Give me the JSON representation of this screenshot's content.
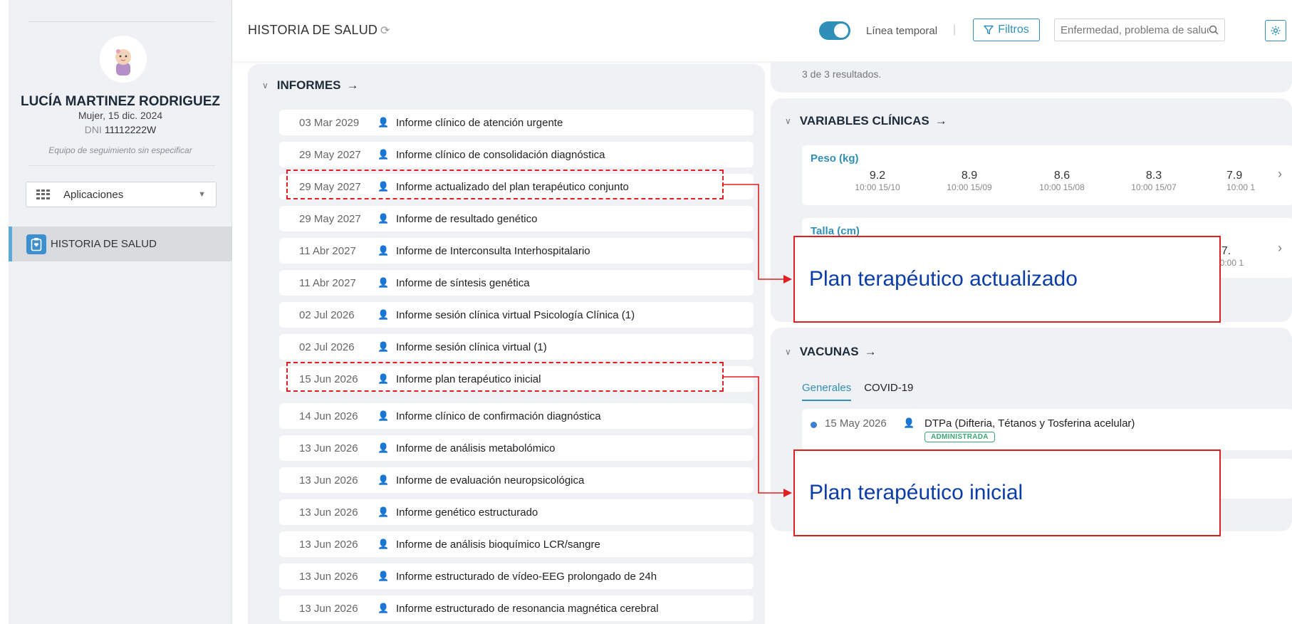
{
  "patient": {
    "name": "LUCÍA MARTINEZ RODRIGUEZ",
    "meta": "Mujer, 15 dic. 2024",
    "dni_label": "DNI",
    "dni_value": "11112222W",
    "team": "Equipo de seguimiento sin especificar"
  },
  "sidebar": {
    "apps_label": "Aplicaciones",
    "nav_item": "HISTORIA DE SALUD"
  },
  "header": {
    "title": "HISTORIA DE SALUD",
    "timeline_label": "Línea temporal",
    "timeline_on": true,
    "filters_label": "Filtros",
    "search_placeholder": "Enfermedad, problema de salud..."
  },
  "informes": {
    "heading": "INFORMES",
    "rows": [
      {
        "date": "03 Mar 2029",
        "title": "Informe clínico de atención urgente"
      },
      {
        "date": "29 May 2027",
        "title": "Informe clínico de consolidación diagnóstica"
      },
      {
        "date": "29 May 2027",
        "title": "Informe actualizado del plan terapéutico conjunto"
      },
      {
        "date": "29 May 2027",
        "title": "Informe de resultado genético"
      },
      {
        "date": "11 Abr 2027",
        "title": "Informe de Interconsulta Interhospitalario"
      },
      {
        "date": "11 Abr 2027",
        "title": "Informe de síntesis genética"
      },
      {
        "date": "02 Jul 2026",
        "title": "Informe sesión clínica virtual Psicología Clínica (1)"
      },
      {
        "date": "02 Jul 2026",
        "title": "Informe sesión clínica virtual (1)"
      },
      {
        "date": "15 Jun 2026",
        "title": "Informe plan terapéutico inicial"
      },
      {
        "date": "14 Jun 2026",
        "title": "Informe clínico de confirmación diagnóstica"
      },
      {
        "date": "13 Jun 2026",
        "title": "Informe de análisis metabolómico"
      },
      {
        "date": "13 Jun 2026",
        "title": "Informe de evaluación neuropsicológica"
      },
      {
        "date": "13 Jun 2026",
        "title": "Informe genético estructurado"
      },
      {
        "date": "13 Jun 2026",
        "title": "Informe de análisis bioquímico LCR/sangre"
      },
      {
        "date": "13 Jun 2026",
        "title": "Informe estructurado de vídeo-EEG prolongado de 24h"
      },
      {
        "date": "13 Jun 2026",
        "title": "Informe estructurado de resonancia magnética cerebral"
      }
    ]
  },
  "results_text": "3 de 3 resultados.",
  "variables": {
    "heading": "VARIABLES CLÍNICAS",
    "peso": {
      "label": "Peso (kg)",
      "values": [
        {
          "n": "9.2",
          "t": "10:00 15/10"
        },
        {
          "n": "8.9",
          "t": "10:00 15/09"
        },
        {
          "n": "8.6",
          "t": "10:00 15/08"
        },
        {
          "n": "8.3",
          "t": "10:00 15/07"
        },
        {
          "n": "7.9",
          "t": "10:00 1"
        }
      ]
    },
    "talla": {
      "label": "Talla (cm)",
      "partial_value": "67.",
      "partial_time": "10:00 1"
    }
  },
  "vacunas": {
    "heading": "VACUNAS",
    "tabs": [
      "Generales",
      "COVID-19"
    ],
    "entry": {
      "date": "15 May 2026",
      "name": "DTPa (Difteria, Tétanos y Tosferina acelular)",
      "status": "ADMINISTRADA"
    }
  },
  "annotations": {
    "callout_top": "Plan terapéutico actualizado",
    "callout_bottom": "Plan terapéutico inicial"
  },
  "icons": [
    "refresh-icon",
    "filter-icon",
    "search-icon",
    "settings-icon",
    "grid-icon",
    "person-icon",
    "clipboard-icon",
    "arrow-right-icon",
    "chevron-down-icon",
    "chevron-right-icon"
  ],
  "colors": {
    "accent": "#2f8fb8",
    "annotation": "#e02020",
    "callout_text": "#0b3da8",
    "badge": "#3aa872"
  }
}
